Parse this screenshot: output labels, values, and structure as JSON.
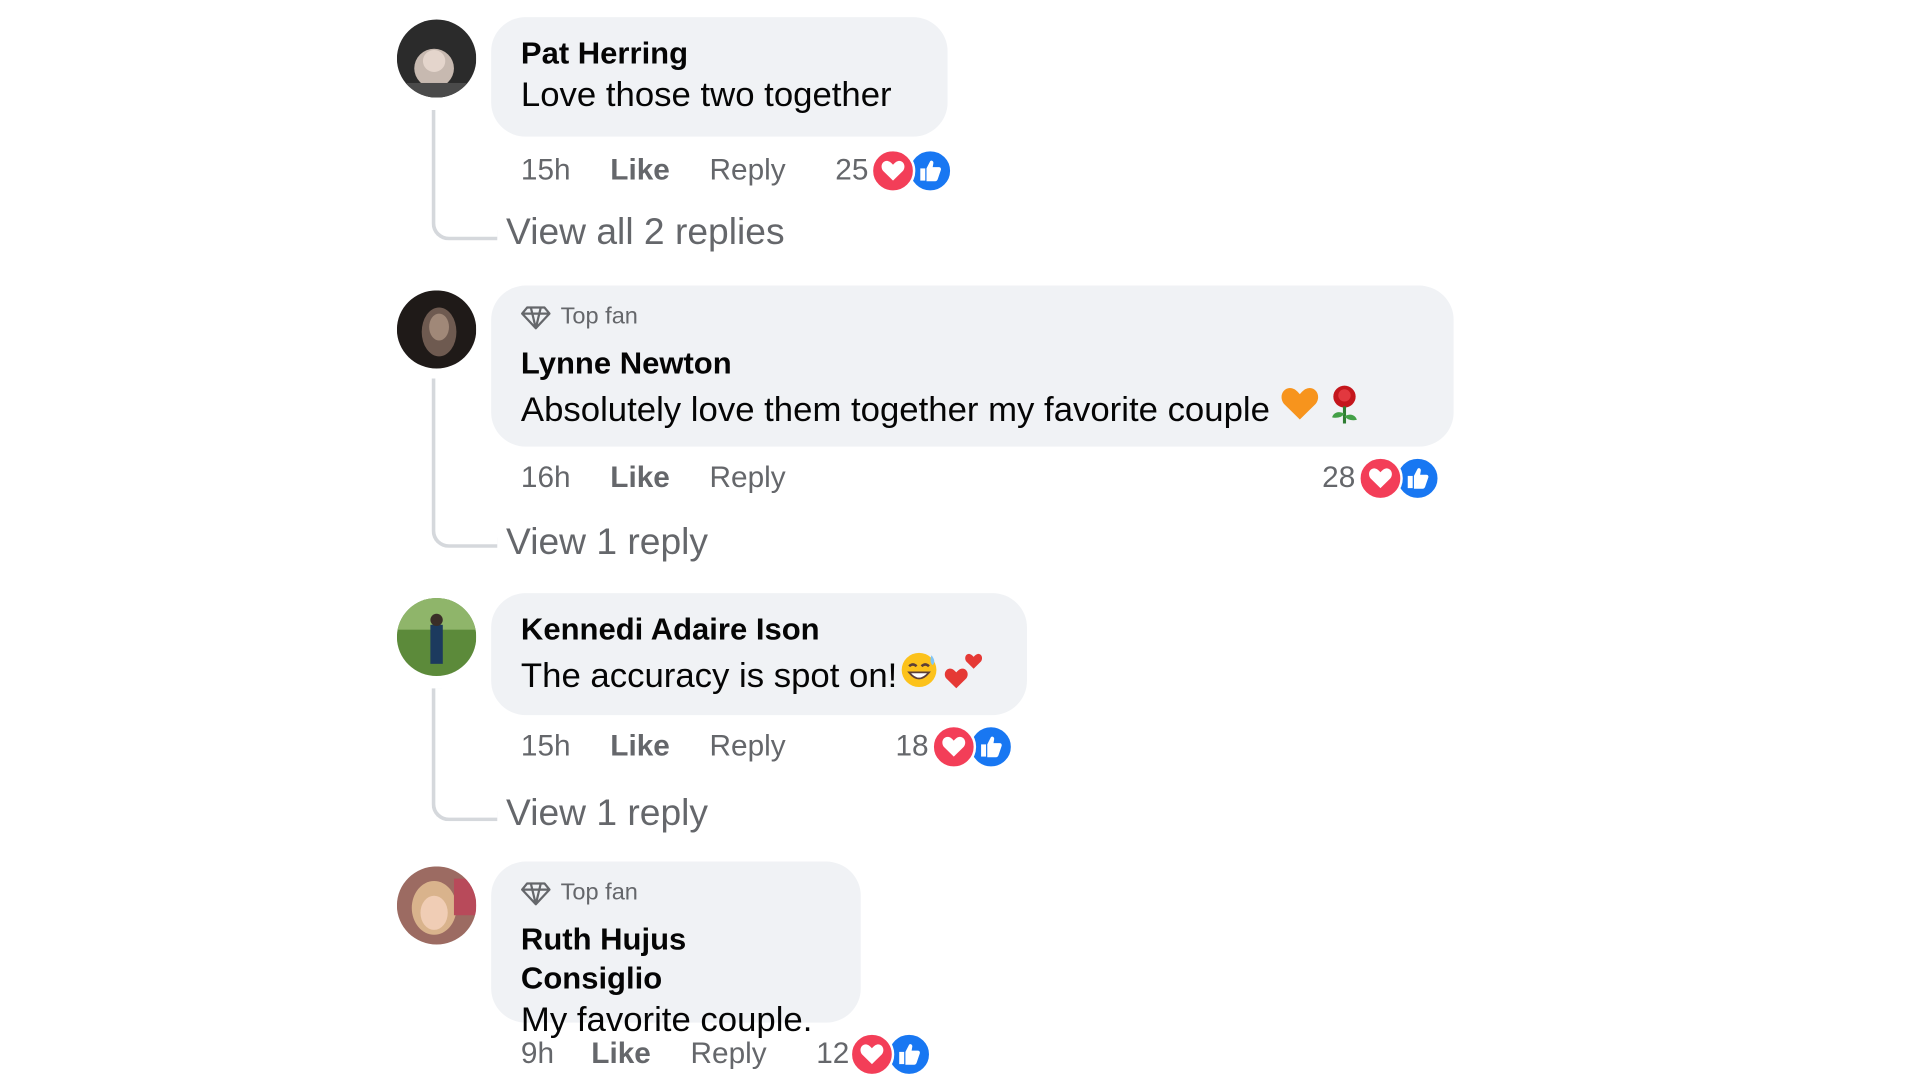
{
  "comments": [
    {
      "author": "Pat Herring",
      "top_fan": false,
      "text": "Love those two together",
      "time": "15h",
      "like_label": "Like",
      "reply_label": "Reply",
      "reaction_count": "25",
      "replies_link": "View all 2 replies"
    },
    {
      "author": "Lynne Newton",
      "top_fan": true,
      "badge_label": "Top fan",
      "text": "Absolutely love them together my favorite couple",
      "emojis": [
        "orange-heart-icon",
        "rose-icon"
      ],
      "time": "16h",
      "like_label": "Like",
      "reply_label": "Reply",
      "reaction_count": "28",
      "replies_link": "View 1 reply"
    },
    {
      "author": "Kennedi Adaire Ison",
      "top_fan": false,
      "text": "The accuracy is spot on!",
      "emojis": [
        "grinning-sweat-icon",
        "two-hearts-icon"
      ],
      "time": "15h",
      "like_label": "Like",
      "reply_label": "Reply",
      "reaction_count": "18",
      "replies_link": "View 1 reply"
    },
    {
      "author": "Ruth Hujus Consiglio",
      "top_fan": true,
      "badge_label": "Top fan",
      "text": "My favorite couple.",
      "time": "9h",
      "like_label": "Like",
      "reply_label": "Reply",
      "reaction_count": "12"
    }
  ],
  "colors": {
    "bubble": "#f0f2f5",
    "heart_reaction": "#f33e58",
    "like_reaction": "#1877f2",
    "secondary_text": "#65676b"
  }
}
